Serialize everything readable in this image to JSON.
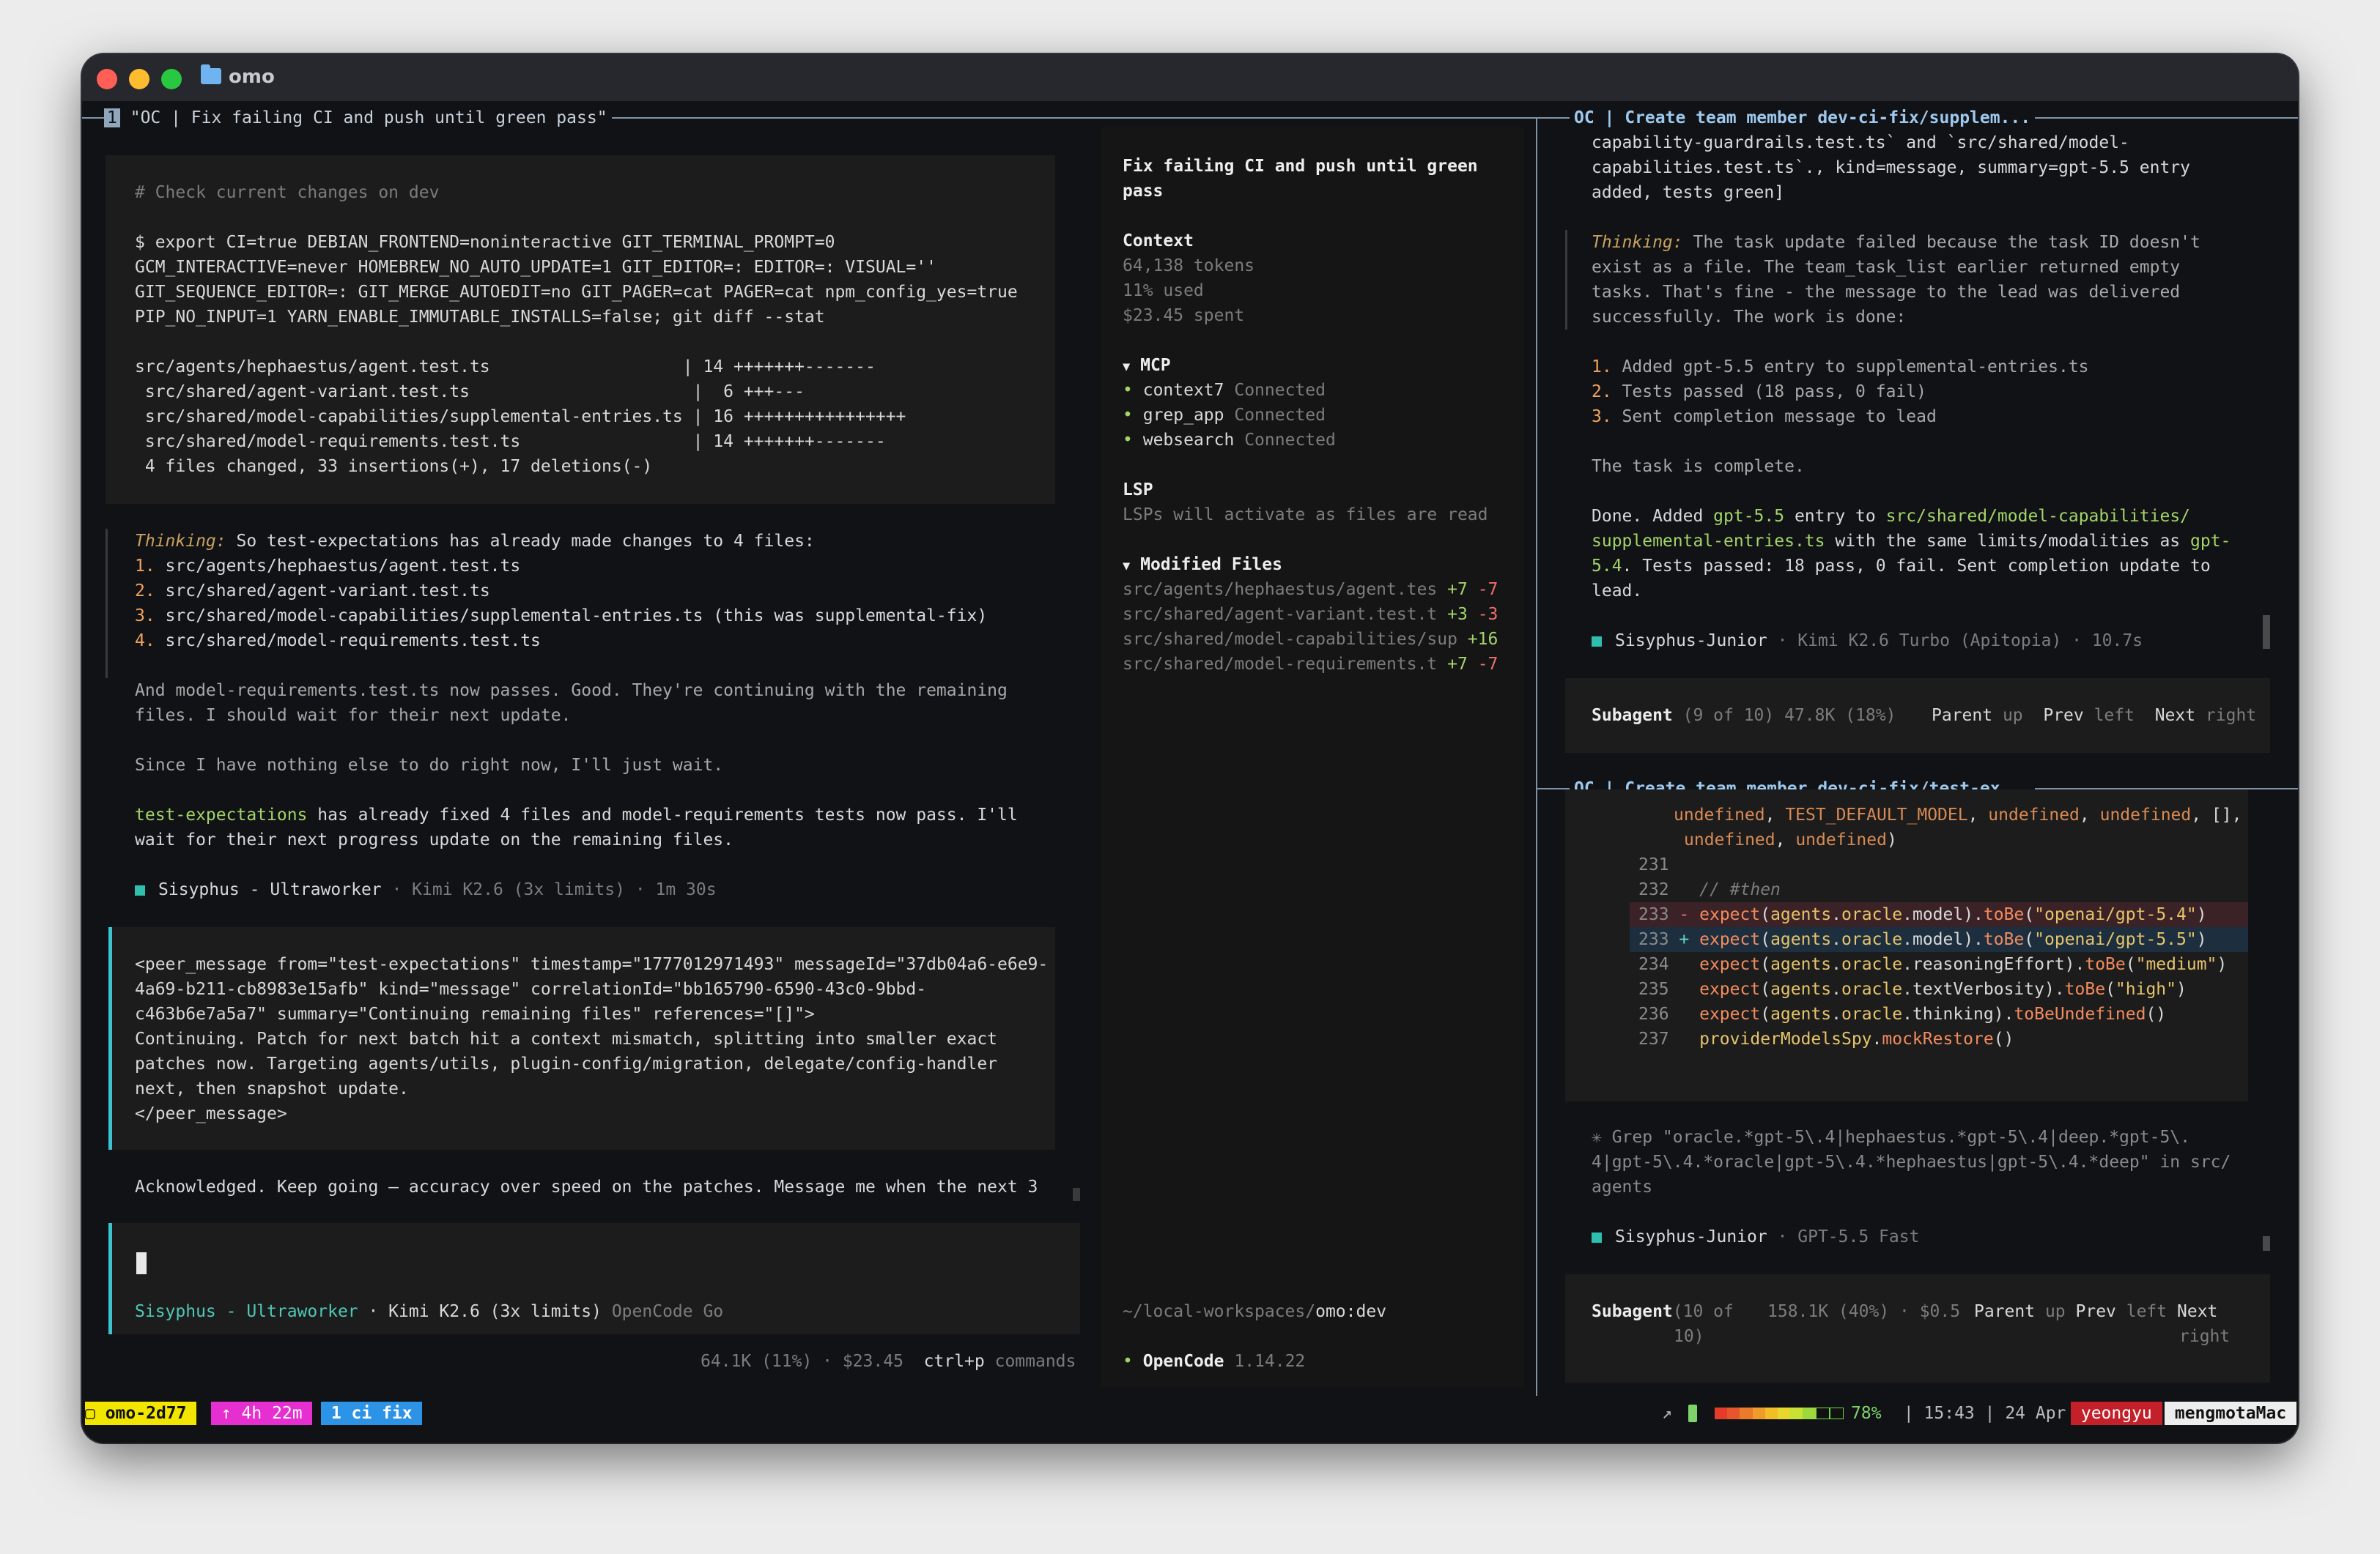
{
  "window": {
    "title": "omo",
    "folder_icon": "folder-icon",
    "traffic_lights": [
      "#ff5f57",
      "#febc2e",
      "#28c840"
    ]
  },
  "tmux": {
    "pane1_index": "1",
    "pane1_title": "\"OC | Fix failing CI and push until green pass\"",
    "pane2_title": "OC | Create team member dev-ci-fix/supplem...",
    "pane3_title": "OC | Create team member dev-ci-fix/test-ex..."
  },
  "main": {
    "cmd_comment": "# Check current changes on dev",
    "cmd_lines": [
      "$ export CI=true DEBIAN_FRONTEND=noninteractive GIT_TERMINAL_PROMPT=0",
      "GCM_INTERACTIVE=never HOMEBREW_NO_AUTO_UPDATE=1 GIT_EDITOR=: EDITOR=: VISUAL=''",
      "GIT_SEQUENCE_EDITOR=: GIT_MERGE_AUTOEDIT=no GIT_PAGER=cat PAGER=cat npm_config_yes=true",
      "PIP_NO_INPUT=1 YARN_ENABLE_IMMUTABLE_INSTALLS=false; git diff --stat"
    ],
    "diffstat": [
      "src/agents/hephaestus/agent.test.ts                   | 14 +++++++-------",
      " src/shared/agent-variant.test.ts                      |  6 +++---",
      " src/shared/model-capabilities/supplemental-entries.ts | 16 ++++++++++++++++",
      " src/shared/model-requirements.test.ts                 | 14 +++++++-------",
      " 4 files changed, 33 insertions(+), 17 deletions(-)"
    ],
    "thinking_label": "Thinking:",
    "thinking_text": " So test-expectations has already made changes to 4 files:",
    "thinking_items": [
      {
        "n": "1.",
        "text": " src/agents/hephaestus/agent.test.ts"
      },
      {
        "n": "2.",
        "text": " src/shared/agent-variant.test.ts"
      },
      {
        "n": "3.",
        "text": " src/shared/model-capabilities/supplemental-entries.ts (this was supplemental-fix)"
      },
      {
        "n": "4.",
        "text": " src/shared/model-requirements.test.ts"
      }
    ],
    "para1": [
      "And model-requirements.test.ts now passes. Good. They're continuing with the remaining",
      "files. I should wait for their next update."
    ],
    "para2": "Since I have nothing else to do right now, I'll just wait.",
    "para3_hl": "test-expectations",
    "para3_a": " has already fixed 4 files and model-requirements tests now pass. I'll",
    "para3_b": "wait for their next progress update on the remaining files.",
    "agent_line": {
      "name": "Sisyphus - Ultraworker",
      "rest": " · Kimi K2.6 (3x limits) · 1m 30s"
    },
    "peer": [
      "<peer_message from=\"test-expectations\" timestamp=\"1777012971493\" messageId=\"37db04a6-e6e9-",
      "4a69-b211-cb8983e15afb\" kind=\"message\" correlationId=\"bb165790-6590-43c0-9bbd-",
      "c463b6e7a5a7\" summary=\"Continuing remaining files\" references=\"[]\">",
      "Continuing. Patch for next batch hit a context mismatch, splitting into smaller exact",
      "patches now. Targeting agents/utils, plugin-config/migration, delegate/config-handler",
      "next, then snapshot update.",
      "</peer_message>"
    ],
    "ack": "Acknowledged. Keep going — accuracy over speed on the patches. Message me when the next 3",
    "prompt_agent": "Sisyphus - Ultraworker",
    "prompt_model": " · Kimi K2.6 (3x limits)",
    "prompt_provider": " OpenCode Go",
    "footer_stats": "64.1K (11%) · $23.45",
    "footer_cmd_key": "ctrl+p",
    "footer_cmd": " commands"
  },
  "sidebar": {
    "title_lines": [
      "Fix failing CI and push until green",
      "pass"
    ],
    "context_label": "Context",
    "tokens": "64,138 tokens",
    "used": "11% used",
    "spent": "$23.45 spent",
    "mcp_label": "MCP",
    "mcp_items": [
      {
        "name": "context7",
        "status": "Connected"
      },
      {
        "name": "grep_app",
        "status": "Connected"
      },
      {
        "name": "websearch",
        "status": "Connected"
      }
    ],
    "lsp_label": "LSP",
    "lsp_text": "LSPs will activate as files are read",
    "modified_label": "Modified Files",
    "files": [
      {
        "path": "src/agents/hephaestus/agent.tes",
        "add": "+7",
        "del": "-7"
      },
      {
        "path": "src/shared/agent-variant.test.t",
        "add": "+3",
        "del": "-3"
      },
      {
        "path": "src/shared/model-capabilities/sup",
        "add": "+16",
        "del": ""
      },
      {
        "path": "src/shared/model-requirements.t",
        "add": "+7",
        "del": "-7"
      }
    ],
    "cwd_prefix": "~/local-workspaces/",
    "cwd_name": "omo:dev",
    "oc_name": "OpenCode",
    "oc_version": " 1.14.22"
  },
  "pane2": {
    "top": [
      "capability-guardrails.test.ts` and `src/shared/model-",
      "capabilities.test.ts`., kind=message, summary=gpt-5.5 entry",
      "added, tests green]"
    ],
    "thinking_label": "Thinking:",
    "thinking_first": " The task update failed because the task ID doesn't",
    "thinking_rest": [
      "exist as a file. The team_task_list earlier returned empty",
      "tasks. That's fine - the message to the lead was delivered",
      "successfully. The work is done:"
    ],
    "list": [
      {
        "n": "1.",
        "text": " Added gpt-5.5 entry to supplemental-entries.ts"
      },
      {
        "n": "2.",
        "text": " Tests passed (18 pass, 0 fail)"
      },
      {
        "n": "3.",
        "text": " Sent completion message to lead"
      }
    ],
    "complete": "The task is complete.",
    "done1_a": "Done. Added ",
    "done1_b": "gpt-5.5",
    "done1_c": " entry to ",
    "done1_d": "src/shared/model-capabilities/",
    "done2_a": "supplemental-entries.ts",
    "done2_b": " with the same limits/modalities as ",
    "done2_c": "gpt-",
    "done3_a": "5.4",
    "done3_b": ". Tests passed: 18 pass, 0 fail. Sent completion update to",
    "done4": "lead.",
    "agent_name": "Sisyphus-Junior",
    "agent_rest": " · Kimi K2.6 Turbo (Apitopia) · 10.7s",
    "sub_label": "Subagent",
    "sub_stats": " (9 of 10) 47.8K (18%)",
    "nav_parent": "Parent",
    "nav_parent_k": " up",
    "nav_prev": "Prev",
    "nav_prev_k": " left",
    "nav_next": "Next",
    "nav_next_k": " right"
  },
  "pane3": {
    "code_top": [
      [
        "undefined",
        ", ",
        "TEST_DEFAULT_MODEL",
        ", ",
        "undefined",
        ", ",
        "undefined",
        ", [],"
      ],
      [
        "undefined",
        ", ",
        "undefined",
        ")"
      ]
    ],
    "lines": [
      {
        "no": "231",
        "sign": "",
        "code": ""
      },
      {
        "no": "232",
        "sign": "",
        "code": "// #then"
      },
      {
        "no": "233",
        "sign": "-",
        "code": "expect(agents.oracle.model).toBe(\"openai/gpt-5.4\")"
      },
      {
        "no": "233",
        "sign": "+",
        "code": "expect(agents.oracle.model).toBe(\"openai/gpt-5.5\")"
      },
      {
        "no": "234",
        "sign": "",
        "code": "expect(agents.oracle.reasoningEffort).toBe(\"medium\")"
      },
      {
        "no": "235",
        "sign": "",
        "code": "expect(agents.oracle.textVerbosity).toBe(\"high\")"
      },
      {
        "no": "236",
        "sign": "",
        "code": "expect(agents.oracle.thinking).toBeUndefined()"
      },
      {
        "no": "237",
        "sign": "",
        "code": "providerModelsSpy.mockRestore()"
      }
    ],
    "grep": [
      "✳ Grep \"oracle.*gpt-5\\.4|hephaestus.*gpt-5\\.4|deep.*gpt-5\\.",
      "4|gpt-5\\.4.*oracle|gpt-5\\.4.*hephaestus|gpt-5\\.4.*deep\" in src/",
      "agents"
    ],
    "agent_name": "Sisyphus-Junior",
    "agent_rest": " · GPT-5.5 Fast",
    "sub_label": "Subagent",
    "sub_a": "(10 of",
    "sub_b": "10)",
    "sub_stats": "158.1K (40%) · $0.5",
    "nav_parent": "Parent",
    "nav_parent_k": " up",
    "nav_prev": "Prev",
    "nav_prev_k": " left",
    "nav_next": "Next",
    "nav_next_k": "right"
  },
  "statusbar": {
    "session": " omo-2d77 ",
    "uptime": " ↑ 4h 22m ",
    "window": " 1 ci fix ",
    "arrow": "↗",
    "battery": "78%",
    "time": " | 15:43 | 24 Apr ",
    "user": " yeongyu ",
    "host": " mengmotaMac ",
    "colors": {
      "session": "#f2e600",
      "uptime": "#e52fd0",
      "window": "#2d93e6",
      "user": "#c4202a",
      "host": "#ededed"
    }
  }
}
